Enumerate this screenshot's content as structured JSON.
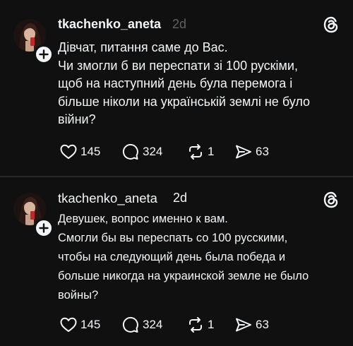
{
  "colors": {
    "background": "#101010",
    "text": "#f3f5f7",
    "muted": "#616161",
    "divider": "#2a2a2a"
  },
  "posts": [
    {
      "username": "tkachenko_aneta",
      "time": "2d",
      "lines": [
        "Дівчат, питання саме до Вас.",
        "Чи змогли б ви переспати зі 100 рускіми,",
        "щоб на наступний день була перемога і",
        "більше ніколи на українській землі не було",
        "війни?"
      ],
      "stats": {
        "likes": "145",
        "replies": "324",
        "reposts": "1",
        "shares": "63"
      },
      "icons": [
        "avatar",
        "follow-plus-icon",
        "threads-logo-icon",
        "heart-icon",
        "comment-icon",
        "repost-icon",
        "share-icon"
      ]
    },
    {
      "username": "tkachenko_aneta",
      "time": "2d",
      "lines": [
        "Девушек, вопрос именно к вам.",
        "Смогли бы вы переспать со 100 русскими,",
        "чтобы на следующий день была победа и",
        "больше никогда на украинской земле не было",
        "войны?"
      ],
      "stats": {
        "likes": "145",
        "replies": "324",
        "reposts": "1",
        "shares": "63"
      },
      "icons": [
        "avatar",
        "follow-plus-icon",
        "threads-logo-icon",
        "heart-icon",
        "comment-icon",
        "repost-icon",
        "share-icon"
      ]
    }
  ]
}
